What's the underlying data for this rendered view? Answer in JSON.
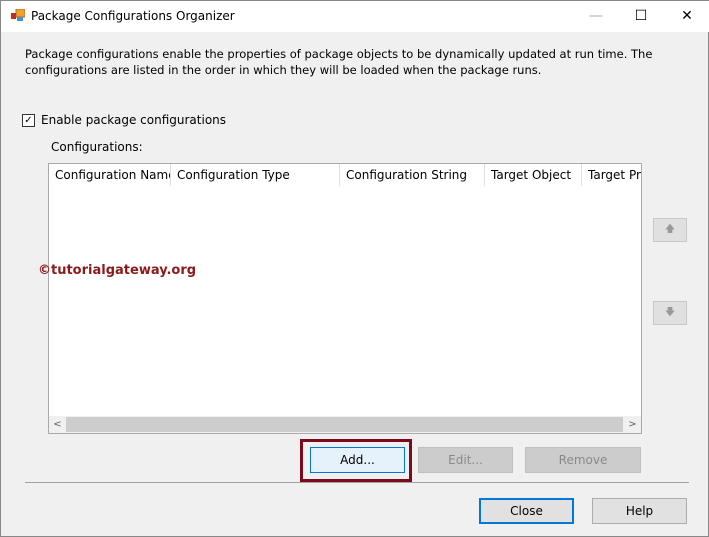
{
  "window": {
    "title": "Package Configurations Organizer",
    "minimize": "—",
    "maximize": "☐",
    "close": "✕"
  },
  "description": "Package configurations enable the properties of package objects to be dynamically updated at run time. The configurations are listed in the order in which they will be loaded when the package runs.",
  "enable_checkbox": {
    "label": "Enable package configurations",
    "checked": true,
    "mark": "✓"
  },
  "configurations_label": "Configurations:",
  "columns": [
    "Configuration Name",
    "Configuration Type",
    "Configuration String",
    "Target Object",
    "Target Property"
  ],
  "watermark": "©tutorialgateway.org",
  "scroll": {
    "left": "<",
    "right": ">"
  },
  "move_up": "🡅",
  "move_down": "🡇",
  "buttons": {
    "add": "Add...",
    "edit": "Edit...",
    "remove": "Remove",
    "close": "Close",
    "help": "Help"
  }
}
